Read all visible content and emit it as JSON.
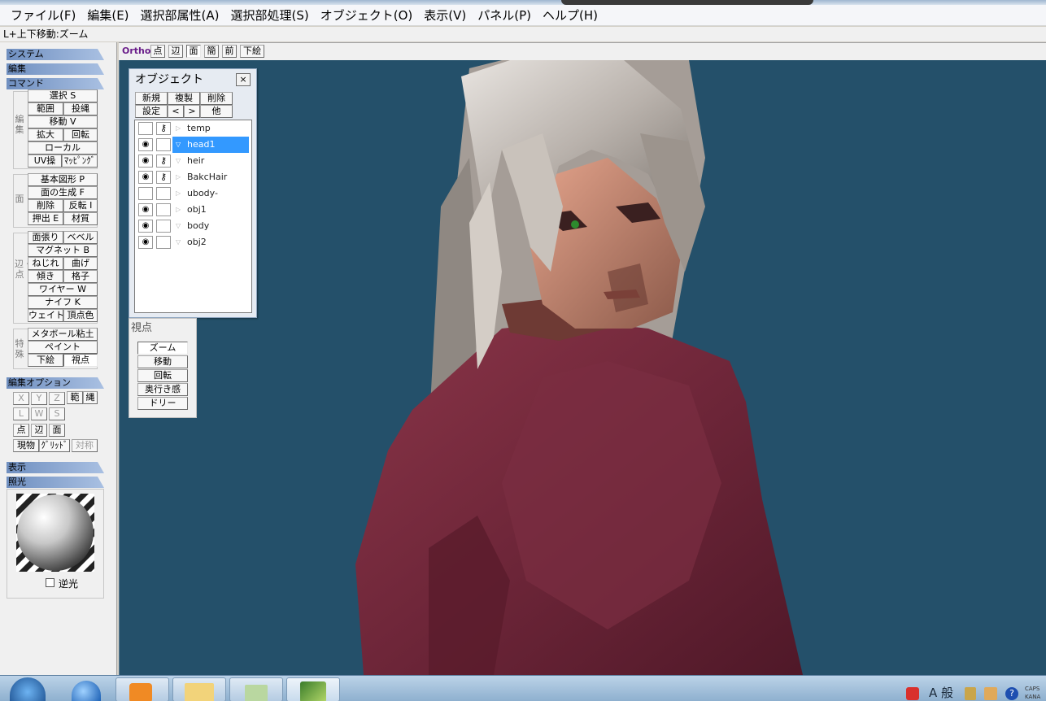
{
  "menu": [
    "ファイル(F)",
    "編集(E)",
    "選択部属性(A)",
    "選択部処理(S)",
    "オブジェクト(O)",
    "表示(V)",
    "パネル(P)",
    "ヘルプ(H)"
  ],
  "status_hint": "L+上下移動:ズーム",
  "sections": {
    "system": "システム",
    "edit": "編集",
    "command": "コマンド",
    "edit_options": "編集オプション",
    "display": "表示",
    "lighting": "照光"
  },
  "group_labels": {
    "edit": "編集",
    "face": "面",
    "edge_point": "辺・点",
    "special": "特殊"
  },
  "cmd": {
    "select": "選択 S",
    "range": "範囲",
    "project": "投縄",
    "move": "移動 V",
    "scale": "拡大",
    "rotate": "回転",
    "local": "ローカル",
    "uv": "UV操",
    "mapping": "ﾏｯﾋﾟﾝｸﾞ",
    "primitive": "基本図形 P",
    "make_face": "面の生成 F",
    "delete": "削除",
    "invert": "反転 I",
    "extrude": "押出 E",
    "material": "材質",
    "face_stretch": "面張り",
    "bevel": "ベベル",
    "magnet": "マグネット B",
    "twist": "ねじれ",
    "bend": "曲げ",
    "tilt": "傾き",
    "lattice": "格子",
    "wire": "ワイヤー W",
    "knife": "ナイフ K",
    "weight": "ウェイト",
    "vertex_color": "頂点色",
    "metaball": "メタボール粘土",
    "paint": "ペイント",
    "sketch": "下絵",
    "viewpoint": "視点"
  },
  "edit_options": {
    "x": "X",
    "y": "Y",
    "z": "Z",
    "range": "範",
    "lasso": "縄",
    "l": "L",
    "w": "W",
    "s": "S",
    "point": "点",
    "edge": "辺",
    "face": "面",
    "current": "現物",
    "grid": "ｸﾞﾘｯﾄﾞ",
    "symmetry": "対称"
  },
  "lighting": {
    "backlight_label": "逆光",
    "backlight_checked": false
  },
  "view_toolbar": {
    "ortho": "Ortho",
    "buttons": [
      "点",
      "辺",
      "面",
      "簡",
      "前",
      "下絵"
    ]
  },
  "object_panel": {
    "title": "オブジェクト",
    "close": "×",
    "buttons_row1": [
      "新規",
      "複製",
      "削除"
    ],
    "buttons_row2": [
      "設定",
      "<",
      ">",
      "他"
    ],
    "objects": [
      {
        "name": "temp",
        "visible": false,
        "locked": true,
        "expanded": false,
        "selected": false
      },
      {
        "name": "head1",
        "visible": true,
        "locked": false,
        "expanded": true,
        "selected": true
      },
      {
        "name": "heir",
        "visible": true,
        "locked": true,
        "expanded": true,
        "selected": false
      },
      {
        "name": "BakcHair",
        "visible": true,
        "locked": true,
        "expanded": false,
        "selected": false
      },
      {
        "name": "ubody-",
        "visible": false,
        "locked": false,
        "expanded": false,
        "selected": false
      },
      {
        "name": "obj1",
        "visible": true,
        "locked": false,
        "expanded": false,
        "selected": false
      },
      {
        "name": "body",
        "visible": true,
        "locked": false,
        "expanded": true,
        "selected": false
      },
      {
        "name": "obj2",
        "visible": true,
        "locked": false,
        "expanded": true,
        "selected": false
      }
    ]
  },
  "view_panel": {
    "title": "視点",
    "buttons": [
      "ズーム",
      "移動",
      "回転",
      "奥行き感",
      "ドリー"
    ],
    "active": "ズーム"
  },
  "taskbar": {
    "ime_mode": "A 般",
    "caps": "CAPS",
    "kana": "KANA"
  },
  "colors": {
    "viewport_bg": "#24506a",
    "selection": "#3399ff",
    "section_header": "#6f8fc0"
  }
}
